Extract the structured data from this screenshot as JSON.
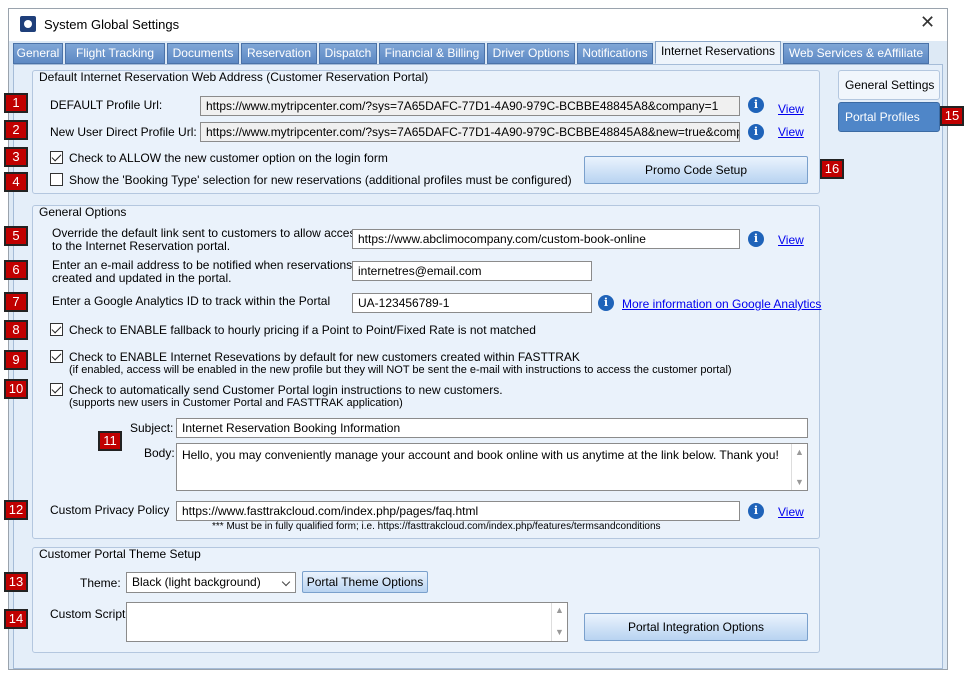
{
  "window": {
    "title": "System Global Settings"
  },
  "tabs": [
    "General",
    "Flight Tracking",
    "Documents",
    "Reservation",
    "Dispatch",
    "Financial & Billing",
    "Driver Options",
    "Notifications",
    "Internet Reservations",
    "Web Services & eAffiliate"
  ],
  "active_tab": "Internet Reservations",
  "side_tabs": {
    "general_settings": "General Settings",
    "portal_profiles": "Portal Profiles"
  },
  "badges": [
    "1",
    "2",
    "3",
    "4",
    "5",
    "6",
    "7",
    "8",
    "9",
    "10",
    "11",
    "12",
    "13",
    "14",
    "15",
    "16"
  ],
  "default_web_address": {
    "title": "Default Internet Reservation Web Address (Customer Reservation Portal)",
    "default_profile_label": "DEFAULT Profile Url:",
    "default_profile_url": "https://www.mytripcenter.com/?sys=7A65DAFC-77D1-4A90-979C-BCBBE48845A8&company=1",
    "new_user_label": "New User Direct Profile Url:",
    "new_user_url": "https://www.mytripcenter.com/?sys=7A65DAFC-77D1-4A90-979C-BCBBE48845A8&new=true&company=",
    "view": "View",
    "allow_new_customer": "Check to ALLOW the new customer option on the login form",
    "show_booking_type": "Show the 'Booking Type' selection for new reservations (additional profiles must be configured)",
    "promo_button": "Promo Code Setup"
  },
  "general_options": {
    "title": "General Options",
    "override_label_1": "Override the default link sent to customers to allow access",
    "override_label_2": "to the Internet Reservation portal.",
    "override_value": "https://www.abclimocompany.com/custom-book-online",
    "email_label_1": "Enter an e-mail address to be notified when reservations are",
    "email_label_2": "created and updated in the portal.",
    "email_value": "internetres@email.com",
    "ga_label": "Enter a Google Analytics ID to track within the Portal",
    "ga_value": "UA-123456789-1",
    "ga_link": "More information on Google Analytics",
    "fallback": "Check to ENABLE fallback to hourly pricing if a Point to Point/Fixed Rate is not matched",
    "enable_default_1": "Check to ENABLE Internet Resevations by default for new customers created within FASTTRAK",
    "enable_default_2": "(if enabled, access will be enabled in the new profile but they will NOT be sent the e-mail with instructions to access the customer portal)",
    "auto_send_1": "Check to automatically send Customer Portal login instructions to new customers.",
    "auto_send_2": "(supports new users in Customer Portal and FASTTRAK application)",
    "subject_label": "Subject:",
    "subject_value": "Internet Reservation Booking Information",
    "body_label": "Body:",
    "body_value": "Hello, you may conveniently manage your account and book online with us anytime at the link below. Thank you!",
    "privacy_label": "Custom Privacy Policy",
    "privacy_value": "https://www.fasttrakcloud.com/index.php/pages/faq.html",
    "privacy_note": "*** Must be in fully qualified form; i.e. https://fasttrakcloud.com/index.php/features/termsandconditions",
    "view": "View"
  },
  "theme_setup": {
    "title": "Customer Portal Theme Setup",
    "theme_label": "Theme:",
    "theme_value": "Black (light background)",
    "theme_options_button": "Portal Theme Options",
    "custom_script_label": "Custom Script:",
    "custom_script_value": "",
    "integration_button": "Portal Integration Options"
  },
  "colors": {
    "badge": "#c00000",
    "tab": "#6b93c9",
    "link": "#0000ee",
    "panel": "#e4eef9"
  }
}
